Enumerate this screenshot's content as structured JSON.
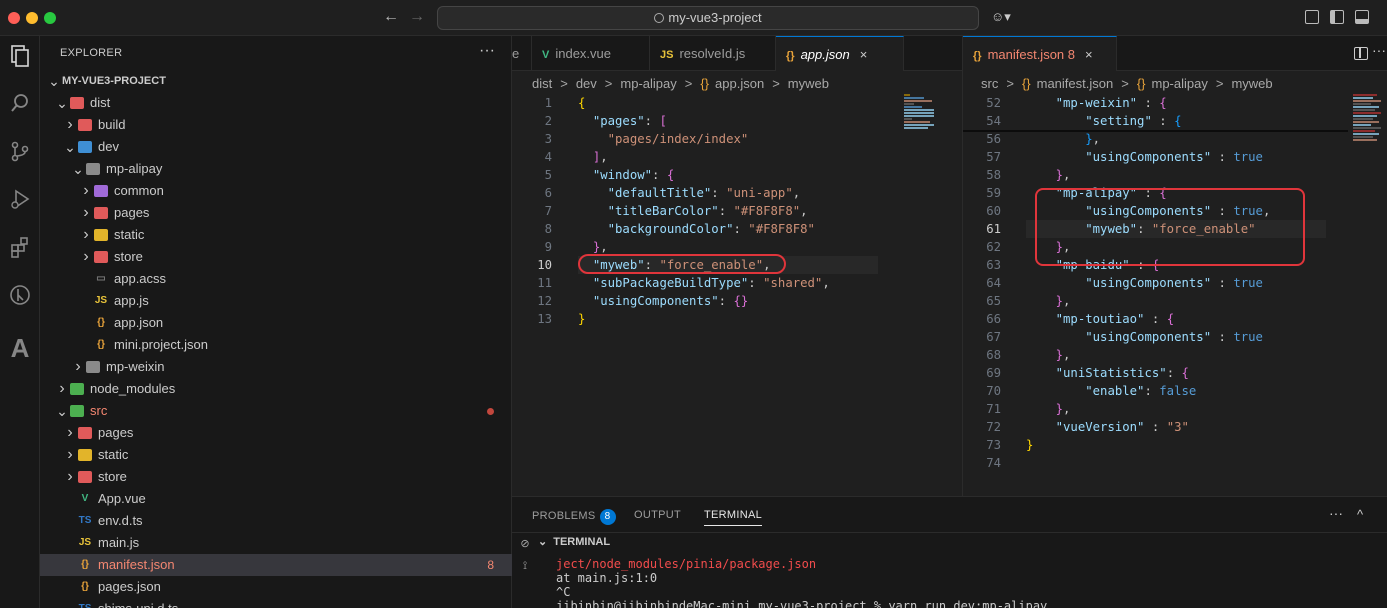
{
  "titlebar": {
    "search_text": "my-vue3-project",
    "back": "←",
    "forward": "→"
  },
  "activity_icons": [
    "explorer-icon",
    "search-icon",
    "source-control-icon",
    "run-debug-icon",
    "extensions-icon",
    "remote-icon",
    "font-icon"
  ],
  "sidebar": {
    "title": "EXPLORER",
    "more": "···",
    "tree": [
      {
        "label": "MY-VUE3-PROJECT",
        "depth": 0,
        "chev": "v",
        "icon": "none",
        "bold": true
      },
      {
        "label": "dist",
        "depth": 1,
        "chev": "v",
        "icon": "folder-red"
      },
      {
        "label": "build",
        "depth": 2,
        "chev": ">",
        "icon": "folder-red"
      },
      {
        "label": "dev",
        "depth": 2,
        "chev": "v",
        "icon": "folder-blue"
      },
      {
        "label": "mp-alipay",
        "depth": 3,
        "chev": "v",
        "icon": "folder-grey"
      },
      {
        "label": "common",
        "depth": 4,
        "chev": ">",
        "icon": "folder-purple"
      },
      {
        "label": "pages",
        "depth": 4,
        "chev": ">",
        "icon": "folder-red"
      },
      {
        "label": "static",
        "depth": 4,
        "chev": ">",
        "icon": "folder-yellow"
      },
      {
        "label": "store",
        "depth": 4,
        "chev": ">",
        "icon": "folder-red"
      },
      {
        "label": "app.acss",
        "depth": 4,
        "chev": "",
        "icon": "file-grey"
      },
      {
        "label": "app.js",
        "depth": 4,
        "chev": "",
        "icon": "file-js"
      },
      {
        "label": "app.json",
        "depth": 4,
        "chev": "",
        "icon": "file-json"
      },
      {
        "label": "mini.project.json",
        "depth": 4,
        "chev": "",
        "icon": "file-json"
      },
      {
        "label": "mp-weixin",
        "depth": 3,
        "chev": ">",
        "icon": "folder-grey"
      },
      {
        "label": "node_modules",
        "depth": 1,
        "chev": ">",
        "icon": "folder-green"
      },
      {
        "label": "src",
        "depth": 1,
        "chev": "v",
        "icon": "folder-green",
        "red": true,
        "dot": true
      },
      {
        "label": "pages",
        "depth": 2,
        "chev": ">",
        "icon": "folder-red"
      },
      {
        "label": "static",
        "depth": 2,
        "chev": ">",
        "icon": "folder-yellow"
      },
      {
        "label": "store",
        "depth": 2,
        "chev": ">",
        "icon": "folder-red"
      },
      {
        "label": "App.vue",
        "depth": 2,
        "chev": "",
        "icon": "file-vue"
      },
      {
        "label": "env.d.ts",
        "depth": 2,
        "chev": "",
        "icon": "file-ts"
      },
      {
        "label": "main.js",
        "depth": 2,
        "chev": "",
        "icon": "file-js"
      },
      {
        "label": "manifest.json",
        "depth": 2,
        "chev": "",
        "icon": "file-json",
        "red": true,
        "selected": true,
        "badge": "8"
      },
      {
        "label": "pages.json",
        "depth": 2,
        "chev": "",
        "icon": "file-json"
      },
      {
        "label": "shims-uni.d.ts",
        "depth": 2,
        "chev": "",
        "icon": "file-ts"
      }
    ]
  },
  "editor1": {
    "tabs": [
      {
        "label": "e",
        "icon": ""
      },
      {
        "label": "index.vue",
        "icon": "vue"
      },
      {
        "label": "resolveId.js",
        "icon": "js"
      },
      {
        "label": "app.json",
        "icon": "json",
        "active": true,
        "italic": true,
        "close": "×"
      }
    ],
    "breadcrumb": [
      "dist",
      ">",
      "dev",
      ">",
      "mp-alipay",
      ">",
      "{}",
      "app.json",
      ">",
      "myweb"
    ],
    "lines": [
      {
        "n": "1",
        "c": [
          [
            "b",
            "{"
          ]
        ]
      },
      {
        "n": "2",
        "c": [
          [
            "p",
            "  "
          ],
          [
            "k",
            "\"pages\""
          ],
          [
            "p",
            ": "
          ],
          [
            "b2",
            "["
          ]
        ]
      },
      {
        "n": "3",
        "c": [
          [
            "p",
            "    "
          ],
          [
            "s",
            "\"pages/index/index\""
          ]
        ]
      },
      {
        "n": "4",
        "c": [
          [
            "p",
            "  "
          ],
          [
            "b2",
            "]"
          ],
          [
            "p",
            ","
          ]
        ]
      },
      {
        "n": "5",
        "c": [
          [
            "p",
            "  "
          ],
          [
            "k",
            "\"window\""
          ],
          [
            "p",
            ": "
          ],
          [
            "b2",
            "{"
          ]
        ]
      },
      {
        "n": "6",
        "c": [
          [
            "p",
            "    "
          ],
          [
            "k",
            "\"defaultTitle\""
          ],
          [
            "p",
            ": "
          ],
          [
            "s",
            "\"uni-app\""
          ],
          [
            "p",
            ","
          ]
        ]
      },
      {
        "n": "7",
        "c": [
          [
            "p",
            "    "
          ],
          [
            "k",
            "\"titleBarColor\""
          ],
          [
            "p",
            ": "
          ],
          [
            "s",
            "\"#F8F8F8\""
          ],
          [
            "p",
            ","
          ]
        ]
      },
      {
        "n": "8",
        "c": [
          [
            "p",
            "    "
          ],
          [
            "k",
            "\"backgroundColor\""
          ],
          [
            "p",
            ": "
          ],
          [
            "s",
            "\"#F8F8F8\""
          ]
        ]
      },
      {
        "n": "9",
        "c": [
          [
            "p",
            "  "
          ],
          [
            "b2",
            "}"
          ],
          [
            "p",
            ","
          ]
        ]
      },
      {
        "n": "10",
        "c": [
          [
            "p",
            "  "
          ],
          [
            "k",
            "\"myweb\""
          ],
          [
            "p",
            ": "
          ],
          [
            "s",
            "\"force_enable\""
          ],
          [
            "p",
            ","
          ]
        ],
        "cur": true
      },
      {
        "n": "11",
        "c": [
          [
            "p",
            "  "
          ],
          [
            "k",
            "\"subPackageBuildType\""
          ],
          [
            "p",
            ": "
          ],
          [
            "s",
            "\"shared\""
          ],
          [
            "p",
            ","
          ]
        ]
      },
      {
        "n": "12",
        "c": [
          [
            "p",
            "  "
          ],
          [
            "k",
            "\"usingComponents\""
          ],
          [
            "p",
            ": "
          ],
          [
            "b2",
            "{}"
          ]
        ]
      },
      {
        "n": "13",
        "c": [
          [
            "b",
            "}"
          ]
        ]
      }
    ]
  },
  "editor2": {
    "tabs": [
      {
        "label": "manifest.json 8",
        "icon": "json",
        "active": true,
        "close": "×"
      }
    ],
    "split_icon": "split-editor-icon",
    "more": "···",
    "breadcrumb": [
      "src",
      ">",
      "{}",
      "manifest.json",
      ">",
      "{}",
      "mp-alipay",
      ">",
      "myweb"
    ],
    "lines": [
      {
        "n": "52",
        "c": [
          [
            "p",
            "    "
          ],
          [
            "k",
            "\"mp-weixin\""
          ],
          [
            "p",
            " : "
          ],
          [
            "b2",
            "{"
          ]
        ]
      },
      {
        "n": "54",
        "c": [
          [
            "p",
            "        "
          ],
          [
            "k",
            "\"setting\""
          ],
          [
            "p",
            " : "
          ],
          [
            "b3",
            "{"
          ]
        ]
      },
      {
        "n": "56",
        "c": [
          [
            "p",
            "        "
          ],
          [
            "b3",
            "}"
          ],
          [
            "p",
            ","
          ]
        ]
      },
      {
        "n": "57",
        "c": [
          [
            "p",
            "        "
          ],
          [
            "k",
            "\"usingComponents\""
          ],
          [
            "p",
            " : "
          ],
          [
            "n",
            "true"
          ]
        ]
      },
      {
        "n": "58",
        "c": [
          [
            "p",
            "    "
          ],
          [
            "b2",
            "}"
          ],
          [
            "p",
            ","
          ]
        ]
      },
      {
        "n": "59",
        "c": [
          [
            "p",
            "    "
          ],
          [
            "k",
            "\"mp-alipay\""
          ],
          [
            "p",
            " : "
          ],
          [
            "b2",
            "{"
          ]
        ]
      },
      {
        "n": "60",
        "c": [
          [
            "p",
            "        "
          ],
          [
            "k",
            "\"usingComponents\""
          ],
          [
            "p",
            " : "
          ],
          [
            "n",
            "true"
          ],
          [
            "p",
            ","
          ]
        ]
      },
      {
        "n": "61",
        "c": [
          [
            "p",
            "        "
          ],
          [
            "k",
            "\"myweb\""
          ],
          [
            "p",
            ": "
          ],
          [
            "s",
            "\"force_enable\""
          ]
        ],
        "cur": true
      },
      {
        "n": "62",
        "c": [
          [
            "p",
            "    "
          ],
          [
            "b2",
            "}"
          ],
          [
            "p",
            ","
          ]
        ]
      },
      {
        "n": "63",
        "c": [
          [
            "p",
            "    "
          ],
          [
            "k",
            "\"mp-baidu\""
          ],
          [
            "p",
            " : "
          ],
          [
            "b2",
            "{"
          ]
        ]
      },
      {
        "n": "64",
        "c": [
          [
            "p",
            "        "
          ],
          [
            "k",
            "\"usingComponents\""
          ],
          [
            "p",
            " : "
          ],
          [
            "n",
            "true"
          ]
        ]
      },
      {
        "n": "65",
        "c": [
          [
            "p",
            "    "
          ],
          [
            "b2",
            "}"
          ],
          [
            "p",
            ","
          ]
        ]
      },
      {
        "n": "66",
        "c": [
          [
            "p",
            "    "
          ],
          [
            "k",
            "\"mp-toutiao\""
          ],
          [
            "p",
            " : "
          ],
          [
            "b2",
            "{"
          ]
        ]
      },
      {
        "n": "67",
        "c": [
          [
            "p",
            "        "
          ],
          [
            "k",
            "\"usingComponents\""
          ],
          [
            "p",
            " : "
          ],
          [
            "n",
            "true"
          ]
        ]
      },
      {
        "n": "68",
        "c": [
          [
            "p",
            "    "
          ],
          [
            "b2",
            "}"
          ],
          [
            "p",
            ","
          ]
        ]
      },
      {
        "n": "69",
        "c": [
          [
            "p",
            "    "
          ],
          [
            "k",
            "\"uniStatistics\""
          ],
          [
            "p",
            ": "
          ],
          [
            "b2",
            "{"
          ]
        ]
      },
      {
        "n": "70",
        "c": [
          [
            "p",
            "        "
          ],
          [
            "k",
            "\"enable\""
          ],
          [
            "p",
            ": "
          ],
          [
            "n",
            "false"
          ]
        ]
      },
      {
        "n": "71",
        "c": [
          [
            "p",
            "    "
          ],
          [
            "b2",
            "}"
          ],
          [
            "p",
            ","
          ]
        ]
      },
      {
        "n": "72",
        "c": [
          [
            "p",
            "    "
          ],
          [
            "k",
            "\"vueVersion\""
          ],
          [
            "p",
            " : "
          ],
          [
            "s",
            "\"3\""
          ]
        ]
      },
      {
        "n": "73",
        "c": [
          [
            "b",
            "}"
          ]
        ]
      },
      {
        "n": "74",
        "c": []
      }
    ]
  },
  "panel": {
    "tabs": [
      {
        "label": "PROBLEMS",
        "badge": "8"
      },
      {
        "label": "OUTPUT"
      },
      {
        "label": "TERMINAL",
        "active": true
      }
    ],
    "more": "···",
    "maximize": "^",
    "section_title": "TERMINAL",
    "terminal_lines": [
      {
        "text": "ject/node_modules/pinia/package.json",
        "color": "#f14c4c"
      },
      {
        "text": "at main.js:1:0",
        "color": "#ccc"
      },
      {
        "text": "^C",
        "color": "#ccc"
      },
      {
        "text": "jibinbin@jibinbindeMac-mini my-vue3-project % yarn run dev:mp-alipay",
        "color": "#ccc"
      }
    ]
  }
}
